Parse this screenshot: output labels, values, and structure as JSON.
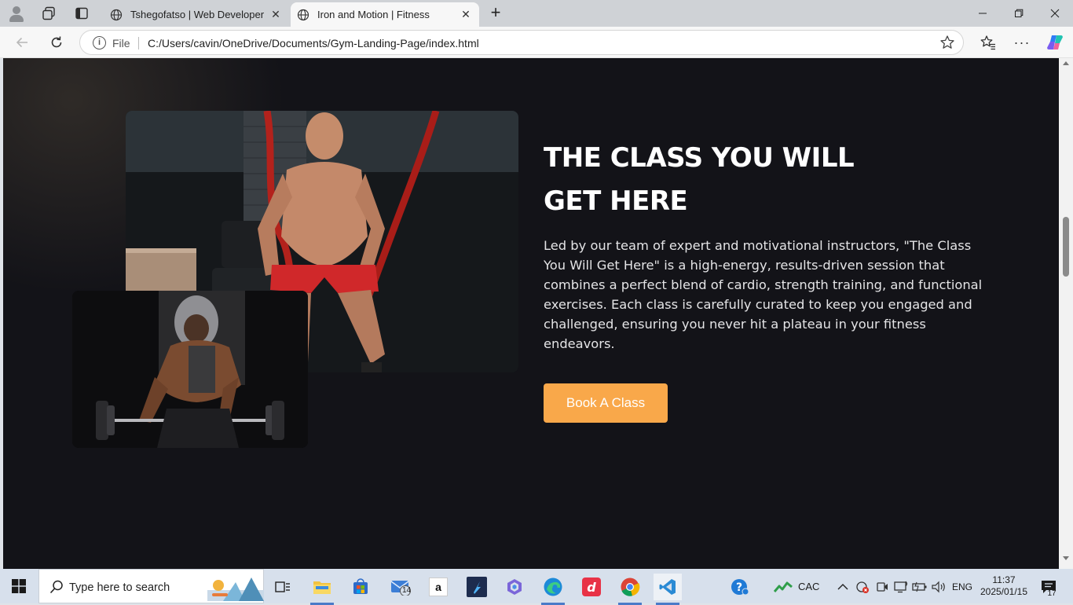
{
  "browser": {
    "tabs": [
      {
        "title": "Tshegofatso | Web Developer",
        "active": false
      },
      {
        "title": "Iron and Motion | Fitness",
        "active": true
      }
    ],
    "address": {
      "scheme_label": "File",
      "url": "C:/Users/cavin/OneDrive/Documents/Gym-Landing-Page/index.html"
    }
  },
  "page": {
    "heading_line1": "THE CLASS YOU WILL",
    "heading_line2": "GET HERE",
    "description": "Led by our team of expert and motivational instructors, \"The Class You Will Get Here\" is a high-energy, results-driven session that combines a perfect blend of cardio, strength training, and functional exercises. Each class is carefully curated to keep you engaged and challenged, ensuring you never hit a plateau in your fitness endeavors.",
    "cta_label": "Book A Class",
    "cta_color": "#f9a84a",
    "background_color": "#131318"
  },
  "taskbar": {
    "search_placeholder": "Type here to search",
    "mail_badge": "14",
    "amazon_letter": "a",
    "tray": {
      "currency_label": "CAC",
      "language": "ENG",
      "time": "11:37",
      "date": "2025/01/15",
      "notification_count": "17"
    }
  }
}
